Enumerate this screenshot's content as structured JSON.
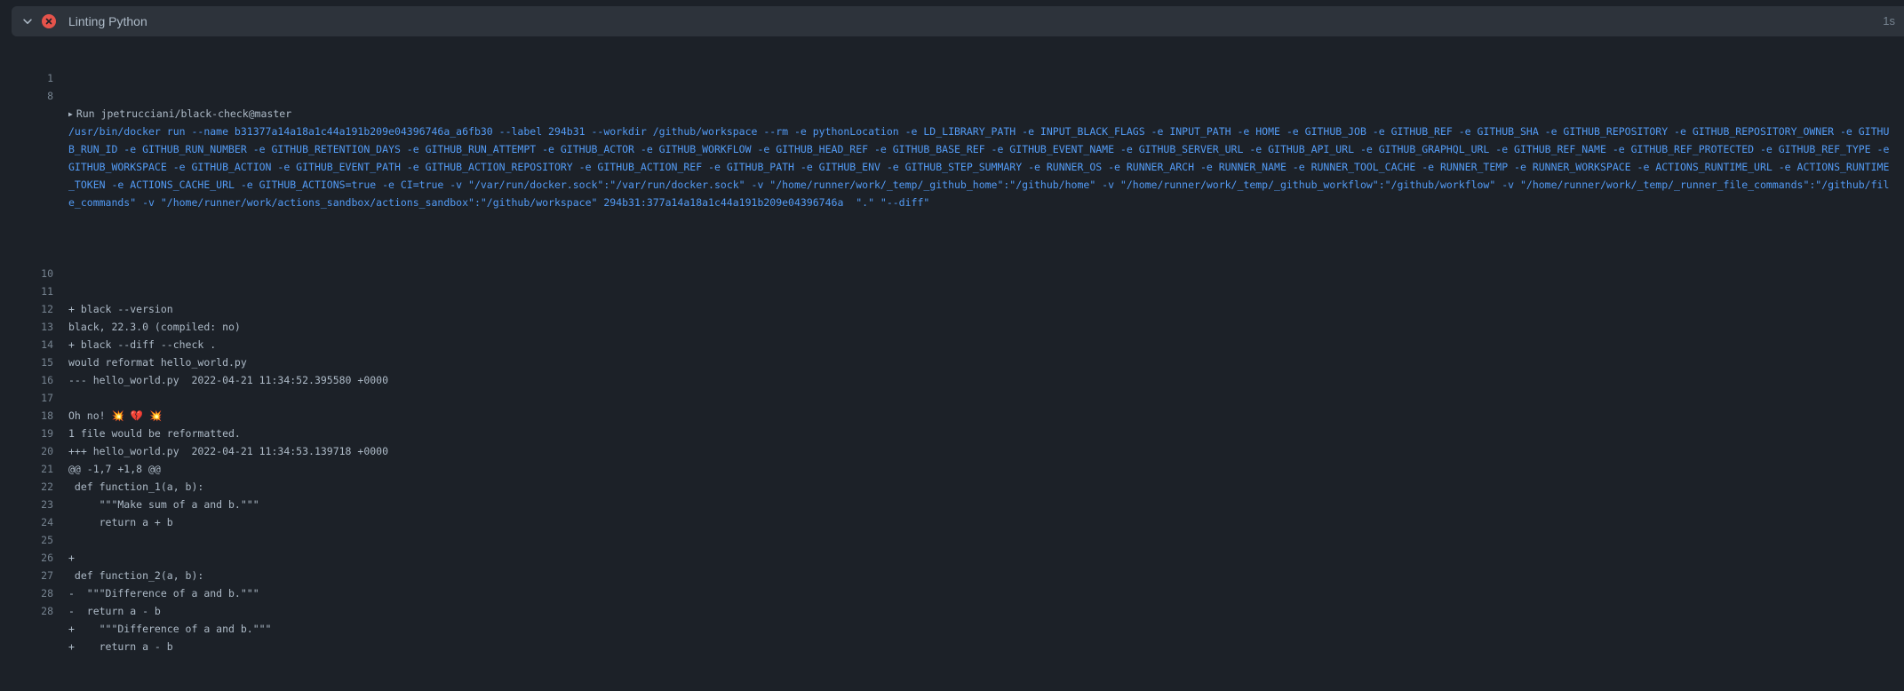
{
  "step": {
    "title": "Linting Python",
    "duration": "1s",
    "status_color": "#e5534b"
  },
  "log": {
    "group_label": "Run jpetrucciani/black-check@master",
    "lines": [
      {
        "num": "8",
        "text": "/usr/bin/docker run --name b31377a14a18a1c44a191b209e04396746a_a6fb30 --label 294b31 --workdir /github/workspace --rm -e pythonLocation -e LD_LIBRARY_PATH -e INPUT_BLACK_FLAGS -e INPUT_PATH -e HOME -e GITHUB_JOB -e GITHUB_REF -e GITHUB_SHA -e GITHUB_REPOSITORY -e GITHUB_REPOSITORY_OWNER -e GITHUB_RUN_ID -e GITHUB_RUN_NUMBER -e GITHUB_RETENTION_DAYS -e GITHUB_RUN_ATTEMPT -e GITHUB_ACTOR -e GITHUB_WORKFLOW -e GITHUB_HEAD_REF -e GITHUB_BASE_REF -e GITHUB_EVENT_NAME -e GITHUB_SERVER_URL -e GITHUB_API_URL -e GITHUB_GRAPHQL_URL -e GITHUB_REF_NAME -e GITHUB_REF_PROTECTED -e GITHUB_REF_TYPE -e GITHUB_WORKSPACE -e GITHUB_ACTION -e GITHUB_EVENT_PATH -e GITHUB_ACTION_REPOSITORY -e GITHUB_ACTION_REF -e GITHUB_PATH -e GITHUB_ENV -e GITHUB_STEP_SUMMARY -e RUNNER_OS -e RUNNER_ARCH -e RUNNER_NAME -e RUNNER_TOOL_CACHE -e RUNNER_TEMP -e RUNNER_WORKSPACE -e ACTIONS_RUNTIME_URL -e ACTIONS_RUNTIME_TOKEN -e ACTIONS_CACHE_URL -e GITHUB_ACTIONS=true -e CI=true -v \"/var/run/docker.sock\":\"/var/run/docker.sock\" -v \"/home/runner/work/_temp/_github_home\":\"/github/home\" -v \"/home/runner/work/_temp/_github_workflow\":\"/github/workflow\" -v \"/home/runner/work/_temp/_runner_file_commands\":\"/github/file_commands\" -v \"/home/runner/work/actions_sandbox/actions_sandbox\":\"/github/workspace\" 294b31:377a14a18a1c44a191b209e04396746a  \".\" \"--diff\""
      },
      {
        "num": "10",
        "text": "+ black --version"
      },
      {
        "num": "11",
        "text": "black, 22.3.0 (compiled: no)"
      },
      {
        "num": "12",
        "text": "+ black --diff --check ."
      },
      {
        "num": "13",
        "text": "would reformat hello_world.py"
      },
      {
        "num": "14",
        "text": "--- hello_world.py  2022-04-21 11:34:52.395580 +0000"
      },
      {
        "num": "15",
        "text": ""
      },
      {
        "num": "16",
        "text": "Oh no! 💥 💔 💥"
      },
      {
        "num": "17",
        "text": "1 file would be reformatted."
      },
      {
        "num": "18",
        "text": "+++ hello_world.py  2022-04-21 11:34:53.139718 +0000"
      },
      {
        "num": "19",
        "text": "@@ -1,7 +1,8 @@"
      },
      {
        "num": "20",
        "text": " def function_1(a, b):"
      },
      {
        "num": "21",
        "text": "     \"\"\"Make sum of a and b.\"\"\""
      },
      {
        "num": "22",
        "text": "     return a + b"
      },
      {
        "num": "23",
        "text": ""
      },
      {
        "num": "24",
        "text": "+"
      },
      {
        "num": "25",
        "text": " def function_2(a, b):"
      },
      {
        "num": "26",
        "text": "-  \"\"\"Difference of a and b.\"\"\""
      },
      {
        "num": "27",
        "text": "-  return a - b"
      },
      {
        "num": "28",
        "text": "+    \"\"\"Difference of a and b.\"\"\""
      },
      {
        "num": "28",
        "text": "+    return a - b"
      }
    ]
  }
}
